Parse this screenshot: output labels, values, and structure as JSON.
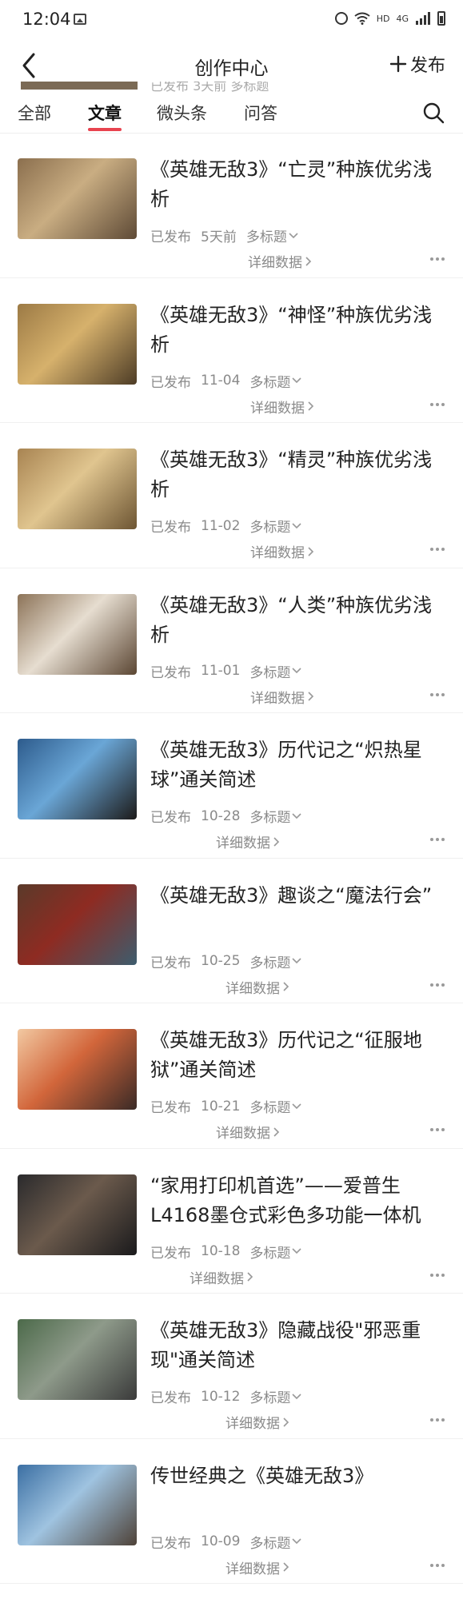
{
  "status": {
    "time": "12:04",
    "net": "HD",
    "gen": "4G"
  },
  "header": {
    "title": "创作中心",
    "publish_label": "发布"
  },
  "peek": {
    "text": "已发布  3天前  多标题"
  },
  "tabs": [
    {
      "label": "全部",
      "active": false
    },
    {
      "label": "文章",
      "active": true
    },
    {
      "label": "微头条",
      "active": false
    },
    {
      "label": "问答",
      "active": false
    }
  ],
  "articles": [
    {
      "title": "《英雄无敌3》“亡灵”种族优劣浅析",
      "status": "已发布",
      "time": "5天前",
      "tag": "多标题",
      "detail": "详细数据",
      "colors": [
        "#8b6f4e",
        "#c9ad82",
        "#5e4a36"
      ]
    },
    {
      "title": "《英雄无敌3》“神怪”种族优劣浅析",
      "status": "已发布",
      "time": "11-04",
      "tag": "多标题",
      "detail": "详细数据",
      "colors": [
        "#9c7a45",
        "#d6b16c",
        "#4d3c26"
      ]
    },
    {
      "title": "《英雄无敌3》“精灵”种族优劣浅析",
      "status": "已发布",
      "time": "11-02",
      "tag": "多标题",
      "detail": "详细数据",
      "colors": [
        "#a88452",
        "#e0c58f",
        "#6d5533"
      ]
    },
    {
      "title": "《英雄无敌3》“人类”种族优劣浅析",
      "status": "已发布",
      "time": "11-01",
      "tag": "多标题",
      "detail": "详细数据",
      "colors": [
        "#8c7358",
        "#e6ddd0",
        "#5b4633"
      ]
    },
    {
      "title": "《英雄无敌3》历代记之“炽热星球”通关简述",
      "status": "已发布",
      "time": "10-28",
      "tag": "多标题",
      "detail": "详细数据",
      "colors": [
        "#2d5b8c",
        "#6aa6d6",
        "#1c1a19"
      ]
    },
    {
      "title": "《英雄无敌3》趣谈之“魔法行会”",
      "status": "已发布",
      "time": "10-25",
      "tag": "多标题",
      "detail": "详细数据",
      "colors": [
        "#5a3a2a",
        "#8e2b22",
        "#3d5d6e"
      ]
    },
    {
      "title": "《英雄无敌3》历代记之“征服地狱”通关简述",
      "status": "已发布",
      "time": "10-21",
      "tag": "多标题",
      "detail": "详细数据",
      "colors": [
        "#f2c9a2",
        "#d2663b",
        "#3a2a26"
      ]
    },
    {
      "title": "“家用打印机首选”——爱普生L4168墨仓式彩色多功能一体机",
      "status": "已发布",
      "time": "10-18",
      "tag": "多标题",
      "detail": "详细数据",
      "colors": [
        "#2a2a2c",
        "#6b5a4c",
        "#1a1a1c"
      ]
    },
    {
      "title": "《英雄无敌3》隐藏战役\"邪恶重现\"通关简述",
      "status": "已发布",
      "time": "10-12",
      "tag": "多标题",
      "detail": "详细数据",
      "colors": [
        "#4c6a4a",
        "#8e9a8a",
        "#3a3a3a"
      ]
    },
    {
      "title": "传世经典之《英雄无敌3》",
      "status": "已发布",
      "time": "10-09",
      "tag": "多标题",
      "detail": "详细数据",
      "colors": [
        "#3b6fa3",
        "#9fc3e0",
        "#4e4238"
      ]
    }
  ]
}
